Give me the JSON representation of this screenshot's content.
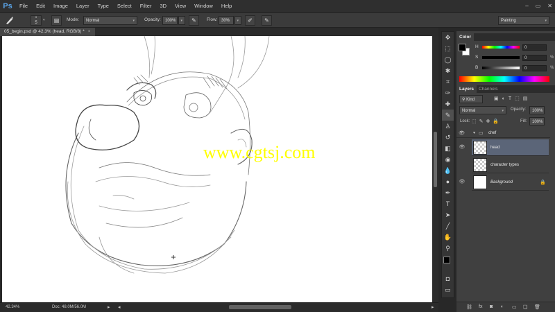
{
  "app": {
    "logo": "Ps"
  },
  "menu": [
    "File",
    "Edit",
    "Image",
    "Layer",
    "Type",
    "Select",
    "Filter",
    "3D",
    "View",
    "Window",
    "Help"
  ],
  "window_controls": {
    "minimize": "–",
    "restore": "▭",
    "close": "✕"
  },
  "options": {
    "brush_size": "5",
    "mode_label": "Mode:",
    "mode_value": "Normal",
    "opacity_label": "Opacity:",
    "opacity_value": "100%",
    "flow_label": "Flow:",
    "flow_value": "30%",
    "workspace": "Painting"
  },
  "document": {
    "tab_title": "05_begin.psd @ 42.3% (head, RGB/8) *",
    "close": "×",
    "watermark": "www.cgtsj.com"
  },
  "status": {
    "zoom": "42.34%",
    "doc": "Doc: 48.0M/56.0M"
  },
  "color_panel": {
    "tab": "Color",
    "labels": [
      "H",
      "S",
      "B"
    ],
    "values": [
      "0",
      "0",
      "0"
    ],
    "unit": "%"
  },
  "layers_panel": {
    "tabs": [
      "Layers",
      "Channels"
    ],
    "kind": "Kind",
    "blend_mode": "Normal",
    "opacity_label": "Opacity:",
    "opacity_value": "100%",
    "lock_label": "Lock:",
    "fill_label": "Fill:",
    "fill_value": "100%",
    "layers": [
      {
        "name": "chef"
      },
      {
        "name": "head"
      },
      {
        "name": "character types"
      },
      {
        "name": "Background"
      }
    ]
  },
  "colors": {
    "accent": "#5aa3e6",
    "selected_layer": "#5b6578",
    "watermark": "#ffff00"
  }
}
